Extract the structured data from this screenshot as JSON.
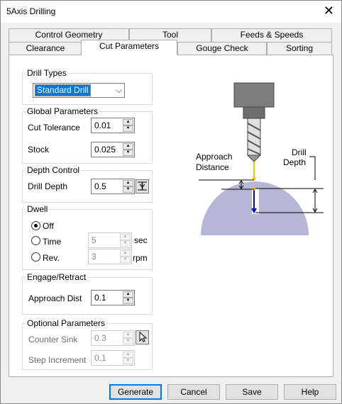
{
  "window": {
    "title": "5Axis Drilling",
    "close_glyph": "✕"
  },
  "tabs_row1": [
    "Control Geometry",
    "Tool",
    "Feeds & Speeds"
  ],
  "tabs_row2": [
    "Clearance",
    "Cut Parameters",
    "Gouge Check",
    "Sorting"
  ],
  "active_tab": "Cut Parameters",
  "drill_types": {
    "label": "Drill Types",
    "selected": "Standard Drill",
    "chevron": "⌵"
  },
  "global": {
    "label": "Global Parameters",
    "cut_tolerance_label": "Cut Tolerance",
    "cut_tolerance": "0.01",
    "stock_label": "Stock",
    "stock": "0.025"
  },
  "depth": {
    "label": "Depth Control",
    "drill_depth_label": "Drill Depth",
    "drill_depth": "0.5"
  },
  "dwell": {
    "label": "Dwell",
    "selected": "Off",
    "off_label": "Off",
    "time_label": "Time",
    "rev_label": "Rev.",
    "time_value": "5",
    "time_unit": "sec",
    "rev_value": "3",
    "rev_unit": "rpm"
  },
  "engage": {
    "label": "Engage/Retract",
    "approach_dist_label": "Approach Dist",
    "approach_dist": "0.1"
  },
  "optional": {
    "label": "Optional Parameters",
    "counter_sink_label": "Counter Sink",
    "counter_sink": "0.3",
    "step_increment_label": "Step Increment",
    "step_increment": "0.1"
  },
  "diagram": {
    "approach_line1": "Approach",
    "approach_line2": "Distance",
    "drill_line1": "Drill",
    "drill_line2": "Depth"
  },
  "buttons": {
    "generate": "Generate",
    "cancel": "Cancel",
    "save": "Save",
    "help": "Help"
  },
  "spin_up": "▲",
  "spin_down": "▼",
  "colors": {
    "accent": "#0078d7",
    "workpiece": "#b4b8d6",
    "tool": "#777777",
    "approach": "#ffc000",
    "depth_line": "#0000cc"
  }
}
